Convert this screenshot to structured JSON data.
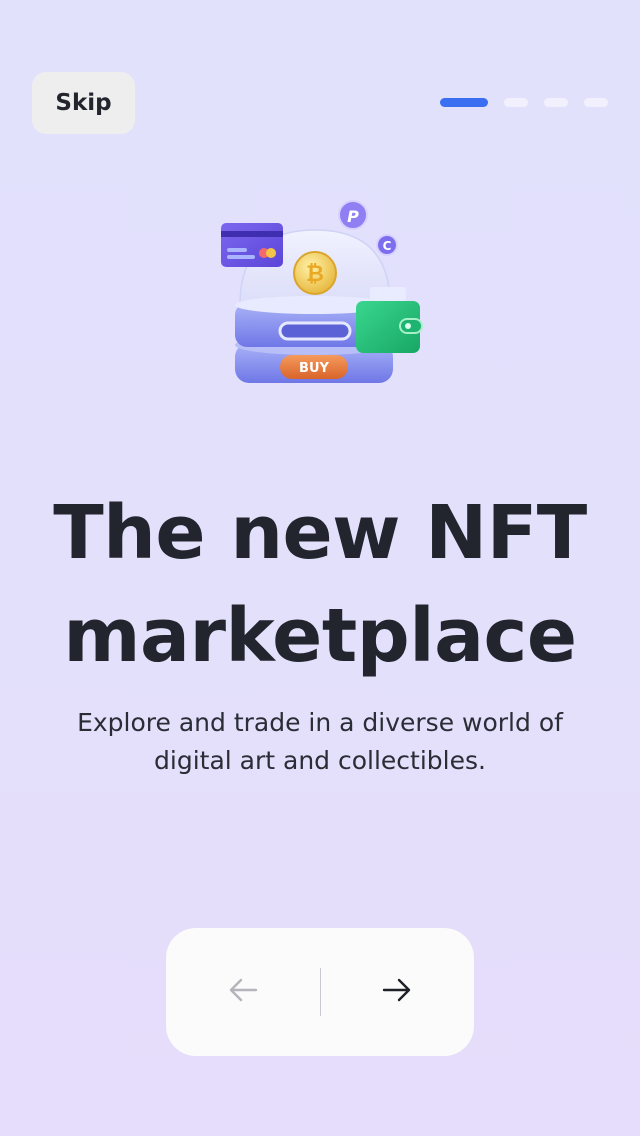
{
  "header": {
    "skip_label": "Skip",
    "pager": {
      "total": 4,
      "active_index": 0,
      "active_color": "#3a6ff2"
    }
  },
  "hero": {
    "illustration_icon": "nft-marketplace-illustration",
    "badge_text": "BUY",
    "title": "The new NFT marketplace",
    "subtitle": "Explore and trade in a diverse world of digital art and collectibles."
  },
  "nav": {
    "prev_icon": "arrow-left-icon",
    "next_icon": "arrow-right-icon",
    "prev_enabled": false,
    "next_enabled": true
  }
}
